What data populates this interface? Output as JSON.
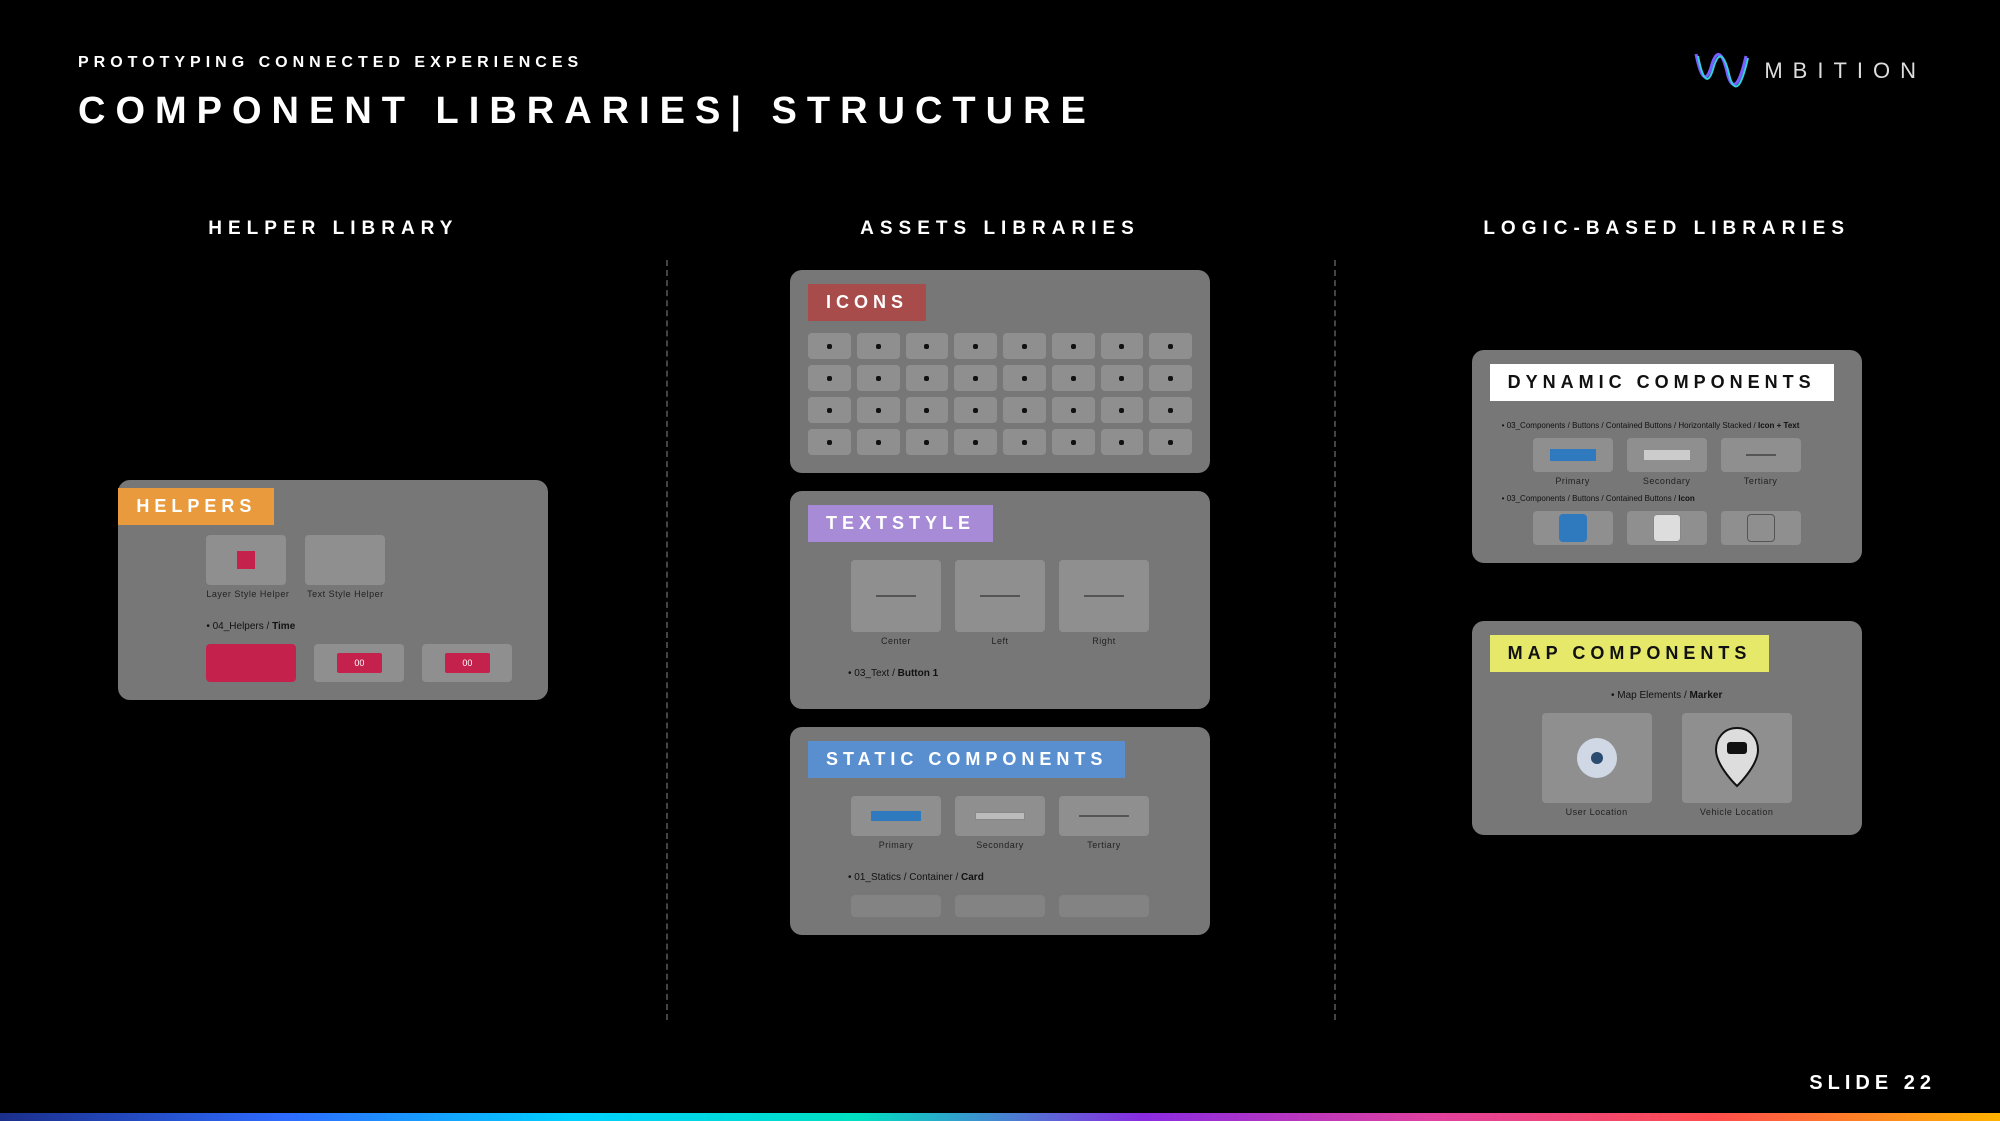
{
  "header": {
    "eyebrow": "PROTOTYPING CONNECTED EXPERIENCES",
    "title": "COMPONENT LIBRARIES| STRUCTURE"
  },
  "logo_text": "MBITION",
  "slide_label": "SLIDE",
  "slide_number": "22",
  "columns": {
    "helper": {
      "title": "HELPER LIBRARY"
    },
    "assets": {
      "title": "ASSETS LIBRARIES"
    },
    "logic": {
      "title": "LOGIC-BASED LIBRARIES"
    }
  },
  "helpers": {
    "label": "HELPERS",
    "item1": "Layer Style Helper",
    "item2": "Text Style Helper",
    "crumb_prefix": "04_Helpers / ",
    "crumb_bold": "Time",
    "pill": "00"
  },
  "icons": {
    "label": "ICONS"
  },
  "textstyle": {
    "label": "TEXTSTYLE",
    "opt1": "Center",
    "opt2": "Left",
    "opt3": "Right",
    "crumb_prefix": "03_Text / ",
    "crumb_bold": "Button 1"
  },
  "static": {
    "label": "STATIC COMPONENTS",
    "opt1": "Primary",
    "opt2": "Secondary",
    "opt3": "Tertiary",
    "crumb_prefix": "01_Statics / Container / ",
    "crumb_bold": "Card"
  },
  "dynamic": {
    "label": "DYNAMIC COMPONENTS",
    "crumb1_prefix": "03_Components / Buttons / Contained Buttons / Horizontally Stacked / ",
    "crumb1_bold": "Icon + Text",
    "opt1": "Primary",
    "opt2": "Secondary",
    "opt3": "Tertiary",
    "crumb2_prefix": "03_Components / Buttons / Contained Buttons / ",
    "crumb2_bold": "Icon"
  },
  "map": {
    "label": "MAP COMPONENTS",
    "crumb_prefix": "Map Elements / ",
    "crumb_bold": "Marker",
    "item1": "User Location",
    "item2": "Vehicle Location"
  }
}
